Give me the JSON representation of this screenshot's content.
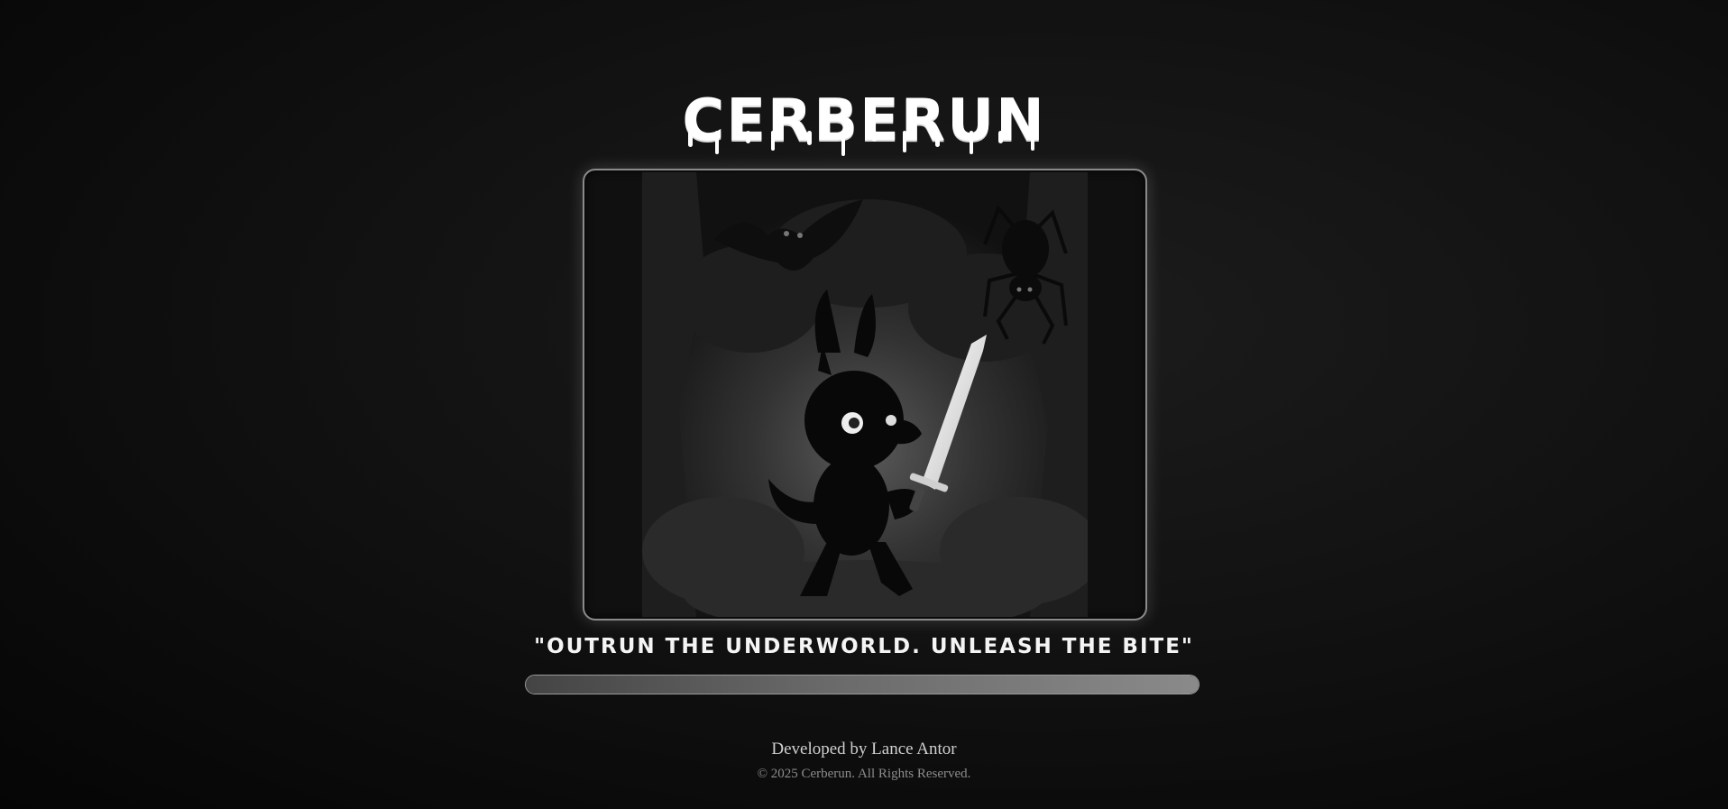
{
  "game": {
    "title": "CERBERUN",
    "tagline": "\"OUTRUN THE UNDERWORLD. UNLEASH THE BITE\"",
    "loading_progress": 1.0
  },
  "footer": {
    "developer": "Developed by Lance Antor",
    "copyright": "© 2025 Cerberun. All Rights Reserved."
  },
  "icons": {
    "art": "dog-with-sword-illustration",
    "enemies": [
      "bat-icon",
      "spider-icon"
    ]
  },
  "colors": {
    "background": "#111111",
    "title": "#ffffff",
    "frame_border": "#8a8a8a",
    "bar_fill": "#7a7a7a"
  }
}
